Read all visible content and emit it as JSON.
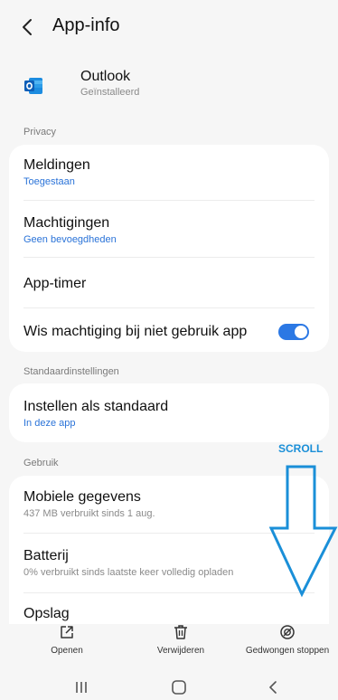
{
  "header": {
    "title": "App-info"
  },
  "app": {
    "name": "Outlook",
    "status": "Geïnstalleerd"
  },
  "sections": {
    "privacy": "Privacy",
    "defaults": "Standaardinstellingen",
    "usage": "Gebruik"
  },
  "privacy_items": {
    "notifications": {
      "title": "Meldingen",
      "subtitle": "Toegestaan"
    },
    "permissions": {
      "title": "Machtigingen",
      "subtitle": "Geen bevoegdheden"
    },
    "app_timer": {
      "title": "App-timer"
    },
    "remove_permissions": {
      "title": "Wis machtiging bij niet gebruik app",
      "enabled": true
    }
  },
  "defaults_items": {
    "set_default": {
      "title": "Instellen als standaard",
      "subtitle": "In deze app"
    }
  },
  "usage_items": {
    "mobile_data": {
      "title": "Mobiele gegevens",
      "subtitle": "437 MB verbruikt sinds 1 aug."
    },
    "battery": {
      "title": "Batterij",
      "subtitle": "0% verbruikt sinds laatste keer volledig opladen"
    },
    "storage": {
      "title": "Opslag"
    }
  },
  "annotation": {
    "scroll_label": "SCROLL",
    "color": "#1a8fd8"
  },
  "bottom_actions": {
    "open": "Openen",
    "uninstall": "Verwijderen",
    "force_stop": "Gedwongen stoppen"
  },
  "colors": {
    "accent": "#2b78e4",
    "link": "#2a73d8",
    "background": "#f6f6f6"
  }
}
